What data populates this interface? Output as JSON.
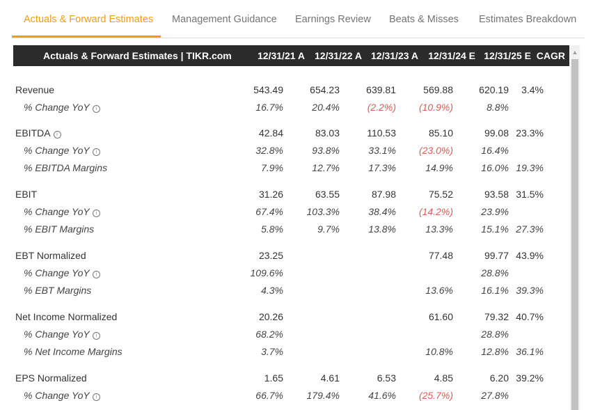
{
  "tabs": [
    {
      "label": "Actuals & Forward Estimates",
      "active": true
    },
    {
      "label": "Management Guidance"
    },
    {
      "label": "Earnings Review"
    },
    {
      "label": "Beats & Misses"
    },
    {
      "label": "Estimates Breakdown"
    }
  ],
  "table": {
    "title": "Actuals & Forward Estimates | TIKR.com",
    "columns": [
      "12/31/21 A",
      "12/31/22 A",
      "12/31/23 A",
      "12/31/24 E",
      "12/31/25 E",
      "CAGR"
    ],
    "info_icon": "i",
    "rows": [
      {
        "label": "Revenue",
        "sub": false,
        "info": false,
        "values": [
          "543.49",
          "654.23",
          "639.81",
          "569.88",
          "620.19",
          "3.4%"
        ]
      },
      {
        "label": "% Change YoY",
        "sub": true,
        "info": true,
        "values": [
          "16.7%",
          "20.4%",
          "(2.2%)",
          "(10.9%)",
          "8.8%",
          ""
        ]
      },
      {
        "label": "EBITDA",
        "sub": false,
        "info": true,
        "values": [
          "42.84",
          "83.03",
          "110.53",
          "85.10",
          "99.08",
          "23.3%"
        ]
      },
      {
        "label": "% Change YoY",
        "sub": true,
        "info": true,
        "values": [
          "32.8%",
          "93.8%",
          "33.1%",
          "(23.0%)",
          "16.4%",
          ""
        ]
      },
      {
        "label": "% EBITDA Margins",
        "sub": true,
        "info": false,
        "values": [
          "7.9%",
          "12.7%",
          "17.3%",
          "14.9%",
          "16.0%",
          "19.3%"
        ]
      },
      {
        "label": "EBIT",
        "sub": false,
        "info": false,
        "values": [
          "31.26",
          "63.55",
          "87.98",
          "75.52",
          "93.58",
          "31.5%"
        ]
      },
      {
        "label": "% Change YoY",
        "sub": true,
        "info": true,
        "values": [
          "67.4%",
          "103.3%",
          "38.4%",
          "(14.2%)",
          "23.9%",
          ""
        ]
      },
      {
        "label": "% EBIT Margins",
        "sub": true,
        "info": false,
        "values": [
          "5.8%",
          "9.7%",
          "13.8%",
          "13.3%",
          "15.1%",
          "27.3%"
        ]
      },
      {
        "label": "EBT Normalized",
        "sub": false,
        "info": false,
        "values": [
          "23.25",
          "",
          "",
          "77.48",
          "99.77",
          "43.9%"
        ]
      },
      {
        "label": "% Change YoY",
        "sub": true,
        "info": true,
        "values": [
          "109.6%",
          "",
          "",
          "",
          "28.8%",
          ""
        ]
      },
      {
        "label": "% EBT Margins",
        "sub": true,
        "info": false,
        "values": [
          "4.3%",
          "",
          "",
          "13.6%",
          "16.1%",
          "39.3%"
        ]
      },
      {
        "label": "Net Income Normalized",
        "sub": false,
        "info": false,
        "values": [
          "20.26",
          "",
          "",
          "61.60",
          "79.32",
          "40.7%"
        ]
      },
      {
        "label": "% Change YoY",
        "sub": true,
        "info": true,
        "values": [
          "68.2%",
          "",
          "",
          "",
          "28.8%",
          ""
        ]
      },
      {
        "label": "% Net Income Margins",
        "sub": true,
        "info": false,
        "values": [
          "3.7%",
          "",
          "",
          "10.8%",
          "12.8%",
          "36.1%"
        ]
      },
      {
        "label": "EPS Normalized",
        "sub": false,
        "info": false,
        "values": [
          "1.65",
          "4.61",
          "6.53",
          "4.85",
          "6.20",
          "39.2%"
        ]
      },
      {
        "label": "% Change YoY",
        "sub": true,
        "info": true,
        "values": [
          "66.7%",
          "179.4%",
          "41.6%",
          "(25.7%)",
          "27.8%",
          ""
        ]
      }
    ]
  },
  "colors": {
    "accent": "#f39c12",
    "header_bg": "#2b2b2b",
    "negative": "#e05a4f"
  },
  "scrollbar": {
    "up_arrow": "▲"
  }
}
